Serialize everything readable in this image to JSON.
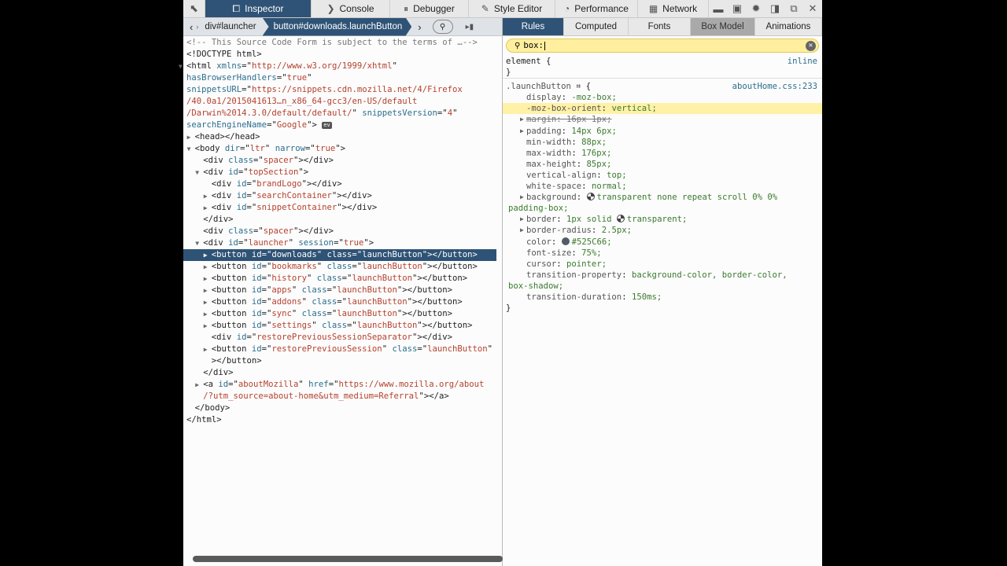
{
  "toolbar": {
    "tabs": [
      {
        "label": "Inspector",
        "icon": "inspector-box-icon",
        "active": true,
        "w": 135
      },
      {
        "label": "Console",
        "icon": "console-chevron-icon",
        "w": 100
      },
      {
        "label": "Debugger",
        "icon": "debugger-pause-icon",
        "w": 100
      },
      {
        "label": "Style Editor",
        "icon": "style-editor-pencil-icon",
        "w": 110
      },
      {
        "label": "Performance",
        "icon": "performance-gauge-icon",
        "w": 105
      },
      {
        "label": "Network",
        "icon": "network-icon",
        "w": 90
      }
    ],
    "pick_icon": "element-picker-icon",
    "right_icons": [
      "split-console-icon",
      "responsive-mode-icon",
      "settings-gear-icon",
      "dock-side-icon",
      "undock-window-icon",
      "close-icon"
    ]
  },
  "breadcrumbs": {
    "items": [
      "div#launcher",
      "button#downloads.launchButton"
    ],
    "selected": 1
  },
  "markup": {
    "lines": [
      {
        "i": 0,
        "c": [
          [
            "cm",
            "<!-- This Source Code Form is subject to the terms of …-->"
          ]
        ]
      },
      {
        "i": 0,
        "c": [
          [
            "tag",
            "<!DOCTYPE html>"
          ]
        ]
      },
      {
        "i": 0,
        "t": "open",
        "c": [
          [
            "tag",
            "<html "
          ],
          [
            "attr",
            "xmlns"
          ],
          [
            "tag",
            "=\""
          ],
          [
            "val",
            "http://www.w3.org/1999/xhtml"
          ],
          [
            "tag",
            "\""
          ]
        ]
      },
      {
        "i": 0,
        "c": [
          [
            "attr",
            "hasBrowserHandlers"
          ],
          [
            "tag",
            "=\""
          ],
          [
            "val",
            "true"
          ],
          [
            "tag",
            "\""
          ]
        ]
      },
      {
        "i": 0,
        "c": [
          [
            "attr",
            "snippetsURL"
          ],
          [
            "tag",
            "=\""
          ],
          [
            "val",
            "https://snippets.cdn.mozilla.net/4/Firefox"
          ]
        ]
      },
      {
        "i": 0,
        "c": [
          [
            "val",
            "/40.0a1/2015041613…n_x86_64-gcc3/en-US/default"
          ]
        ]
      },
      {
        "i": 0,
        "c": [
          [
            "val",
            "/Darwin%2014.3.0/default/default/"
          ],
          [
            "tag",
            "\" "
          ],
          [
            "attr",
            "snippetsVersion"
          ],
          [
            "tag",
            "=\""
          ],
          [
            "val",
            "4"
          ],
          [
            "tag",
            "\""
          ]
        ]
      },
      {
        "i": 0,
        "ev": "ev",
        "c": [
          [
            "attr",
            "searchEngineName"
          ],
          [
            "tag",
            "=\""
          ],
          [
            "val",
            "Google"
          ],
          [
            "tag",
            "\"> "
          ]
        ]
      },
      {
        "i": 1,
        "t": "closed",
        "c": [
          [
            "tag",
            "<head></head>"
          ]
        ]
      },
      {
        "i": 1,
        "t": "open",
        "c": [
          [
            "tag",
            "<body "
          ],
          [
            "attr",
            "dir"
          ],
          [
            "tag",
            "=\""
          ],
          [
            "val",
            "ltr"
          ],
          [
            "tag",
            "\" "
          ],
          [
            "attr",
            "narrow"
          ],
          [
            "tag",
            "=\""
          ],
          [
            "val",
            "true"
          ],
          [
            "tag",
            "\">"
          ]
        ]
      },
      {
        "i": 2,
        "c": [
          [
            "tag",
            "<div "
          ],
          [
            "attr",
            "class"
          ],
          [
            "tag",
            "=\""
          ],
          [
            "val",
            "spacer"
          ],
          [
            "tag",
            "\"></div>"
          ]
        ]
      },
      {
        "i": 2,
        "t": "open",
        "c": [
          [
            "tag",
            "<div "
          ],
          [
            "attr",
            "id"
          ],
          [
            "tag",
            "=\""
          ],
          [
            "val",
            "topSection"
          ],
          [
            "tag",
            "\">"
          ]
        ]
      },
      {
        "i": 3,
        "c": [
          [
            "tag",
            "<div "
          ],
          [
            "attr",
            "id"
          ],
          [
            "tag",
            "=\""
          ],
          [
            "val",
            "brandLogo"
          ],
          [
            "tag",
            "\"></div>"
          ]
        ]
      },
      {
        "i": 3,
        "t": "closed",
        "c": [
          [
            "tag",
            "<div "
          ],
          [
            "attr",
            "id"
          ],
          [
            "tag",
            "=\""
          ],
          [
            "val",
            "searchContainer"
          ],
          [
            "tag",
            "\"></div>"
          ]
        ]
      },
      {
        "i": 3,
        "t": "closed",
        "c": [
          [
            "tag",
            "<div "
          ],
          [
            "attr",
            "id"
          ],
          [
            "tag",
            "=\""
          ],
          [
            "val",
            "snippetContainer"
          ],
          [
            "tag",
            "\"></div>"
          ]
        ]
      },
      {
        "i": 2,
        "c": [
          [
            "tag",
            "</div>"
          ]
        ]
      },
      {
        "i": 2,
        "c": [
          [
            "tag",
            "<div "
          ],
          [
            "attr",
            "class"
          ],
          [
            "tag",
            "=\""
          ],
          [
            "val",
            "spacer"
          ],
          [
            "tag",
            "\"></div>"
          ]
        ]
      },
      {
        "i": 2,
        "t": "open",
        "c": [
          [
            "tag",
            "<div "
          ],
          [
            "attr",
            "id"
          ],
          [
            "tag",
            "=\""
          ],
          [
            "val",
            "launcher"
          ],
          [
            "tag",
            "\" "
          ],
          [
            "attr",
            "session"
          ],
          [
            "tag",
            "=\""
          ],
          [
            "val",
            "true"
          ],
          [
            "tag",
            "\">"
          ]
        ]
      },
      {
        "i": 3,
        "t": "closed",
        "sel": true,
        "c": [
          [
            "tag",
            "<button "
          ],
          [
            "attr",
            "id"
          ],
          [
            "tag",
            "=\""
          ],
          [
            "val",
            "downloads"
          ],
          [
            "tag",
            "\" "
          ],
          [
            "attr",
            "class"
          ],
          [
            "tag",
            "=\""
          ],
          [
            "val",
            "launchButton"
          ],
          [
            "tag",
            "\"></button>"
          ]
        ]
      },
      {
        "i": 3,
        "t": "closed",
        "c": [
          [
            "tag",
            "<button "
          ],
          [
            "attr",
            "id"
          ],
          [
            "tag",
            "=\""
          ],
          [
            "val",
            "bookmarks"
          ],
          [
            "tag",
            "\" "
          ],
          [
            "attr",
            "class"
          ],
          [
            "tag",
            "=\""
          ],
          [
            "val",
            "launchButton"
          ],
          [
            "tag",
            "\"></button>"
          ]
        ]
      },
      {
        "i": 3,
        "t": "closed",
        "c": [
          [
            "tag",
            "<button "
          ],
          [
            "attr",
            "id"
          ],
          [
            "tag",
            "=\""
          ],
          [
            "val",
            "history"
          ],
          [
            "tag",
            "\" "
          ],
          [
            "attr",
            "class"
          ],
          [
            "tag",
            "=\""
          ],
          [
            "val",
            "launchButton"
          ],
          [
            "tag",
            "\"></button>"
          ]
        ]
      },
      {
        "i": 3,
        "t": "closed",
        "c": [
          [
            "tag",
            "<button "
          ],
          [
            "attr",
            "id"
          ],
          [
            "tag",
            "=\""
          ],
          [
            "val",
            "apps"
          ],
          [
            "tag",
            "\" "
          ],
          [
            "attr",
            "class"
          ],
          [
            "tag",
            "=\""
          ],
          [
            "val",
            "launchButton"
          ],
          [
            "tag",
            "\"></button>"
          ]
        ]
      },
      {
        "i": 3,
        "t": "closed",
        "c": [
          [
            "tag",
            "<button "
          ],
          [
            "attr",
            "id"
          ],
          [
            "tag",
            "=\""
          ],
          [
            "val",
            "addons"
          ],
          [
            "tag",
            "\" "
          ],
          [
            "attr",
            "class"
          ],
          [
            "tag",
            "=\""
          ],
          [
            "val",
            "launchButton"
          ],
          [
            "tag",
            "\"></button>"
          ]
        ]
      },
      {
        "i": 3,
        "t": "closed",
        "c": [
          [
            "tag",
            "<button "
          ],
          [
            "attr",
            "id"
          ],
          [
            "tag",
            "=\""
          ],
          [
            "val",
            "sync"
          ],
          [
            "tag",
            "\" "
          ],
          [
            "attr",
            "class"
          ],
          [
            "tag",
            "=\""
          ],
          [
            "val",
            "launchButton"
          ],
          [
            "tag",
            "\"></button>"
          ]
        ]
      },
      {
        "i": 3,
        "t": "closed",
        "c": [
          [
            "tag",
            "<button "
          ],
          [
            "attr",
            "id"
          ],
          [
            "tag",
            "=\""
          ],
          [
            "val",
            "settings"
          ],
          [
            "tag",
            "\" "
          ],
          [
            "attr",
            "class"
          ],
          [
            "tag",
            "=\""
          ],
          [
            "val",
            "launchButton"
          ],
          [
            "tag",
            "\"></button>"
          ]
        ]
      },
      {
        "i": 3,
        "c": [
          [
            "tag",
            "<div "
          ],
          [
            "attr",
            "id"
          ],
          [
            "tag",
            "=\""
          ],
          [
            "val",
            "restorePreviousSessionSeparator"
          ],
          [
            "tag",
            "\"></div>"
          ]
        ]
      },
      {
        "i": 3,
        "t": "closed",
        "c": [
          [
            "tag",
            "<button "
          ],
          [
            "attr",
            "id"
          ],
          [
            "tag",
            "=\""
          ],
          [
            "val",
            "restorePreviousSession"
          ],
          [
            "tag",
            "\" "
          ],
          [
            "attr",
            "class"
          ],
          [
            "tag",
            "=\""
          ],
          [
            "val",
            "launchButton"
          ],
          [
            "tag",
            "\""
          ]
        ]
      },
      {
        "i": 3,
        "c": [
          [
            "tag",
            "></button>"
          ]
        ]
      },
      {
        "i": 2,
        "c": [
          [
            "tag",
            "</div>"
          ]
        ]
      },
      {
        "i": 2,
        "t": "closed",
        "c": [
          [
            "tag",
            "<a "
          ],
          [
            "attr",
            "id"
          ],
          [
            "tag",
            "=\""
          ],
          [
            "val",
            "aboutMozilla"
          ],
          [
            "tag",
            "\" "
          ],
          [
            "attr",
            "href"
          ],
          [
            "tag",
            "=\""
          ],
          [
            "val",
            "https://www.mozilla.org/about"
          ]
        ]
      },
      {
        "i": 2,
        "c": [
          [
            "val",
            "/?utm_source=about-home&utm_medium=Referral"
          ],
          [
            "tag",
            "\"></a>"
          ]
        ]
      },
      {
        "i": 1,
        "c": [
          [
            "tag",
            "</body>"
          ]
        ]
      },
      {
        "i": 0,
        "c": [
          [
            "tag",
            "</html>"
          ]
        ]
      }
    ]
  },
  "sidebar": {
    "tabs": [
      {
        "label": "Rules",
        "active": true,
        "w": 78
      },
      {
        "label": "Computed",
        "w": 82
      },
      {
        "label": "Fonts",
        "w": 79
      },
      {
        "label": "Box Model",
        "hl": true,
        "w": 82
      },
      {
        "label": "Animations",
        "w": 85
      }
    ],
    "filter_value": "box:",
    "filter_icon": "search-icon",
    "clear_icon": "clear-filter-icon"
  },
  "rules": {
    "element": {
      "selector": "element {",
      "close": "}",
      "source": "inline"
    },
    "launch": {
      "selector": ".launchButton",
      "brace": "{",
      "close": "}",
      "source": "aboutHome.css:233",
      "icon": "highlight-selector-icon",
      "props": [
        {
          "n": "display",
          "v": "-moz-box;"
        },
        {
          "n": "-moz-box-orient",
          "v": "vertical;",
          "hl": true
        },
        {
          "n": "margin",
          "v": "16px 1px;",
          "t": true,
          "strike": true
        },
        {
          "n": "padding",
          "v": "14px 6px;",
          "t": true
        },
        {
          "n": "min-width",
          "v": "88px;"
        },
        {
          "n": "max-width",
          "v": "176px;"
        },
        {
          "n": "max-height",
          "v": "85px;"
        },
        {
          "n": "vertical-align",
          "v": "top;"
        },
        {
          "n": "white-space",
          "v": "normal;"
        },
        {
          "n": "background",
          "v": "transparent none repeat scroll 0% 0%",
          "cont": "padding-box;",
          "t": true,
          "sw": "transparent"
        },
        {
          "n": "border",
          "v": "1px solid ",
          "v2": "transparent;",
          "t": true,
          "sw2": "transparent"
        },
        {
          "n": "border-radius",
          "v": "2.5px;",
          "t": true
        },
        {
          "n": "color",
          "v": "#525C66;",
          "sw": "#525C66"
        },
        {
          "n": "font-size",
          "v": "75%;"
        },
        {
          "n": "cursor",
          "v": "pointer;"
        },
        {
          "n": "transition-property",
          "v": "background-color, border-color,",
          "cont": "box-shadow;"
        },
        {
          "n": "transition-duration",
          "v": "150ms;"
        }
      ]
    }
  },
  "colors": {
    "accent": "#2f5376",
    "highlight": "#fff1a6",
    "filter_bg": "#ffef9e"
  }
}
